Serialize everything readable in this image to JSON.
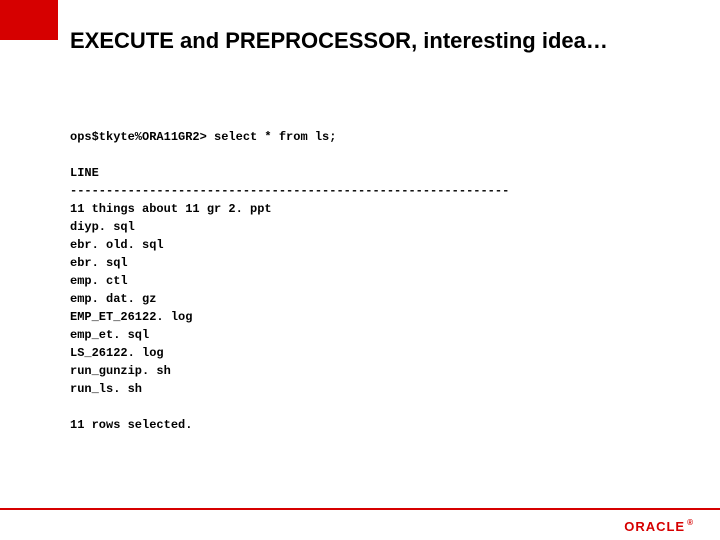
{
  "title": "EXECUTE and PREPROCESSOR, interesting idea…",
  "prompt": "ops$tkyte%ORA11GR2> select * from ls;",
  "col_header": "LINE",
  "dashes": "-------------------------------------------------------------",
  "rows": [
    "11 things about 11 gr 2. ppt",
    "diyp. sql",
    "ebr. old. sql",
    "ebr. sql",
    "emp. ctl",
    "emp. dat. gz",
    "EMP_ET_26122. log",
    "emp_et. sql",
    "LS_26122. log",
    "run_gunzip. sh",
    "run_ls. sh"
  ],
  "summary": "11 rows selected.",
  "logo_text": "ORACLE",
  "logo_reg": "®"
}
